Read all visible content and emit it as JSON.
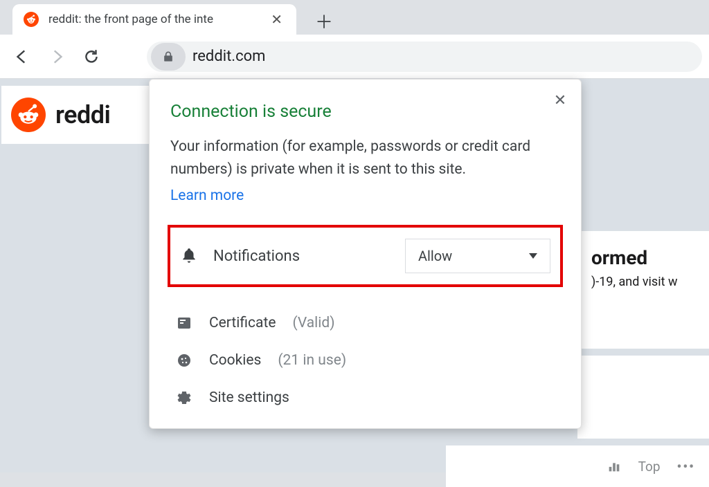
{
  "tab": {
    "title": "reddit: the front page of the inte"
  },
  "url": {
    "text": "reddit.com"
  },
  "brand": {
    "text": "reddi"
  },
  "popover": {
    "title": "Connection is secure",
    "description": "Your information (for example, passwords or credit card numbers) is private when it is sent to this site.",
    "learn_more": "Learn more",
    "notifications": {
      "label": "Notifications",
      "value": "Allow"
    },
    "certificate": {
      "label": "Certificate",
      "status": "(Valid)"
    },
    "cookies": {
      "label": "Cookies",
      "status": "(21 in use)"
    },
    "site_settings": {
      "label": "Site settings"
    }
  },
  "side": {
    "heading": "ormed",
    "body": ")-19, and visit w",
    "top_label": "Top",
    "more": "•••"
  }
}
